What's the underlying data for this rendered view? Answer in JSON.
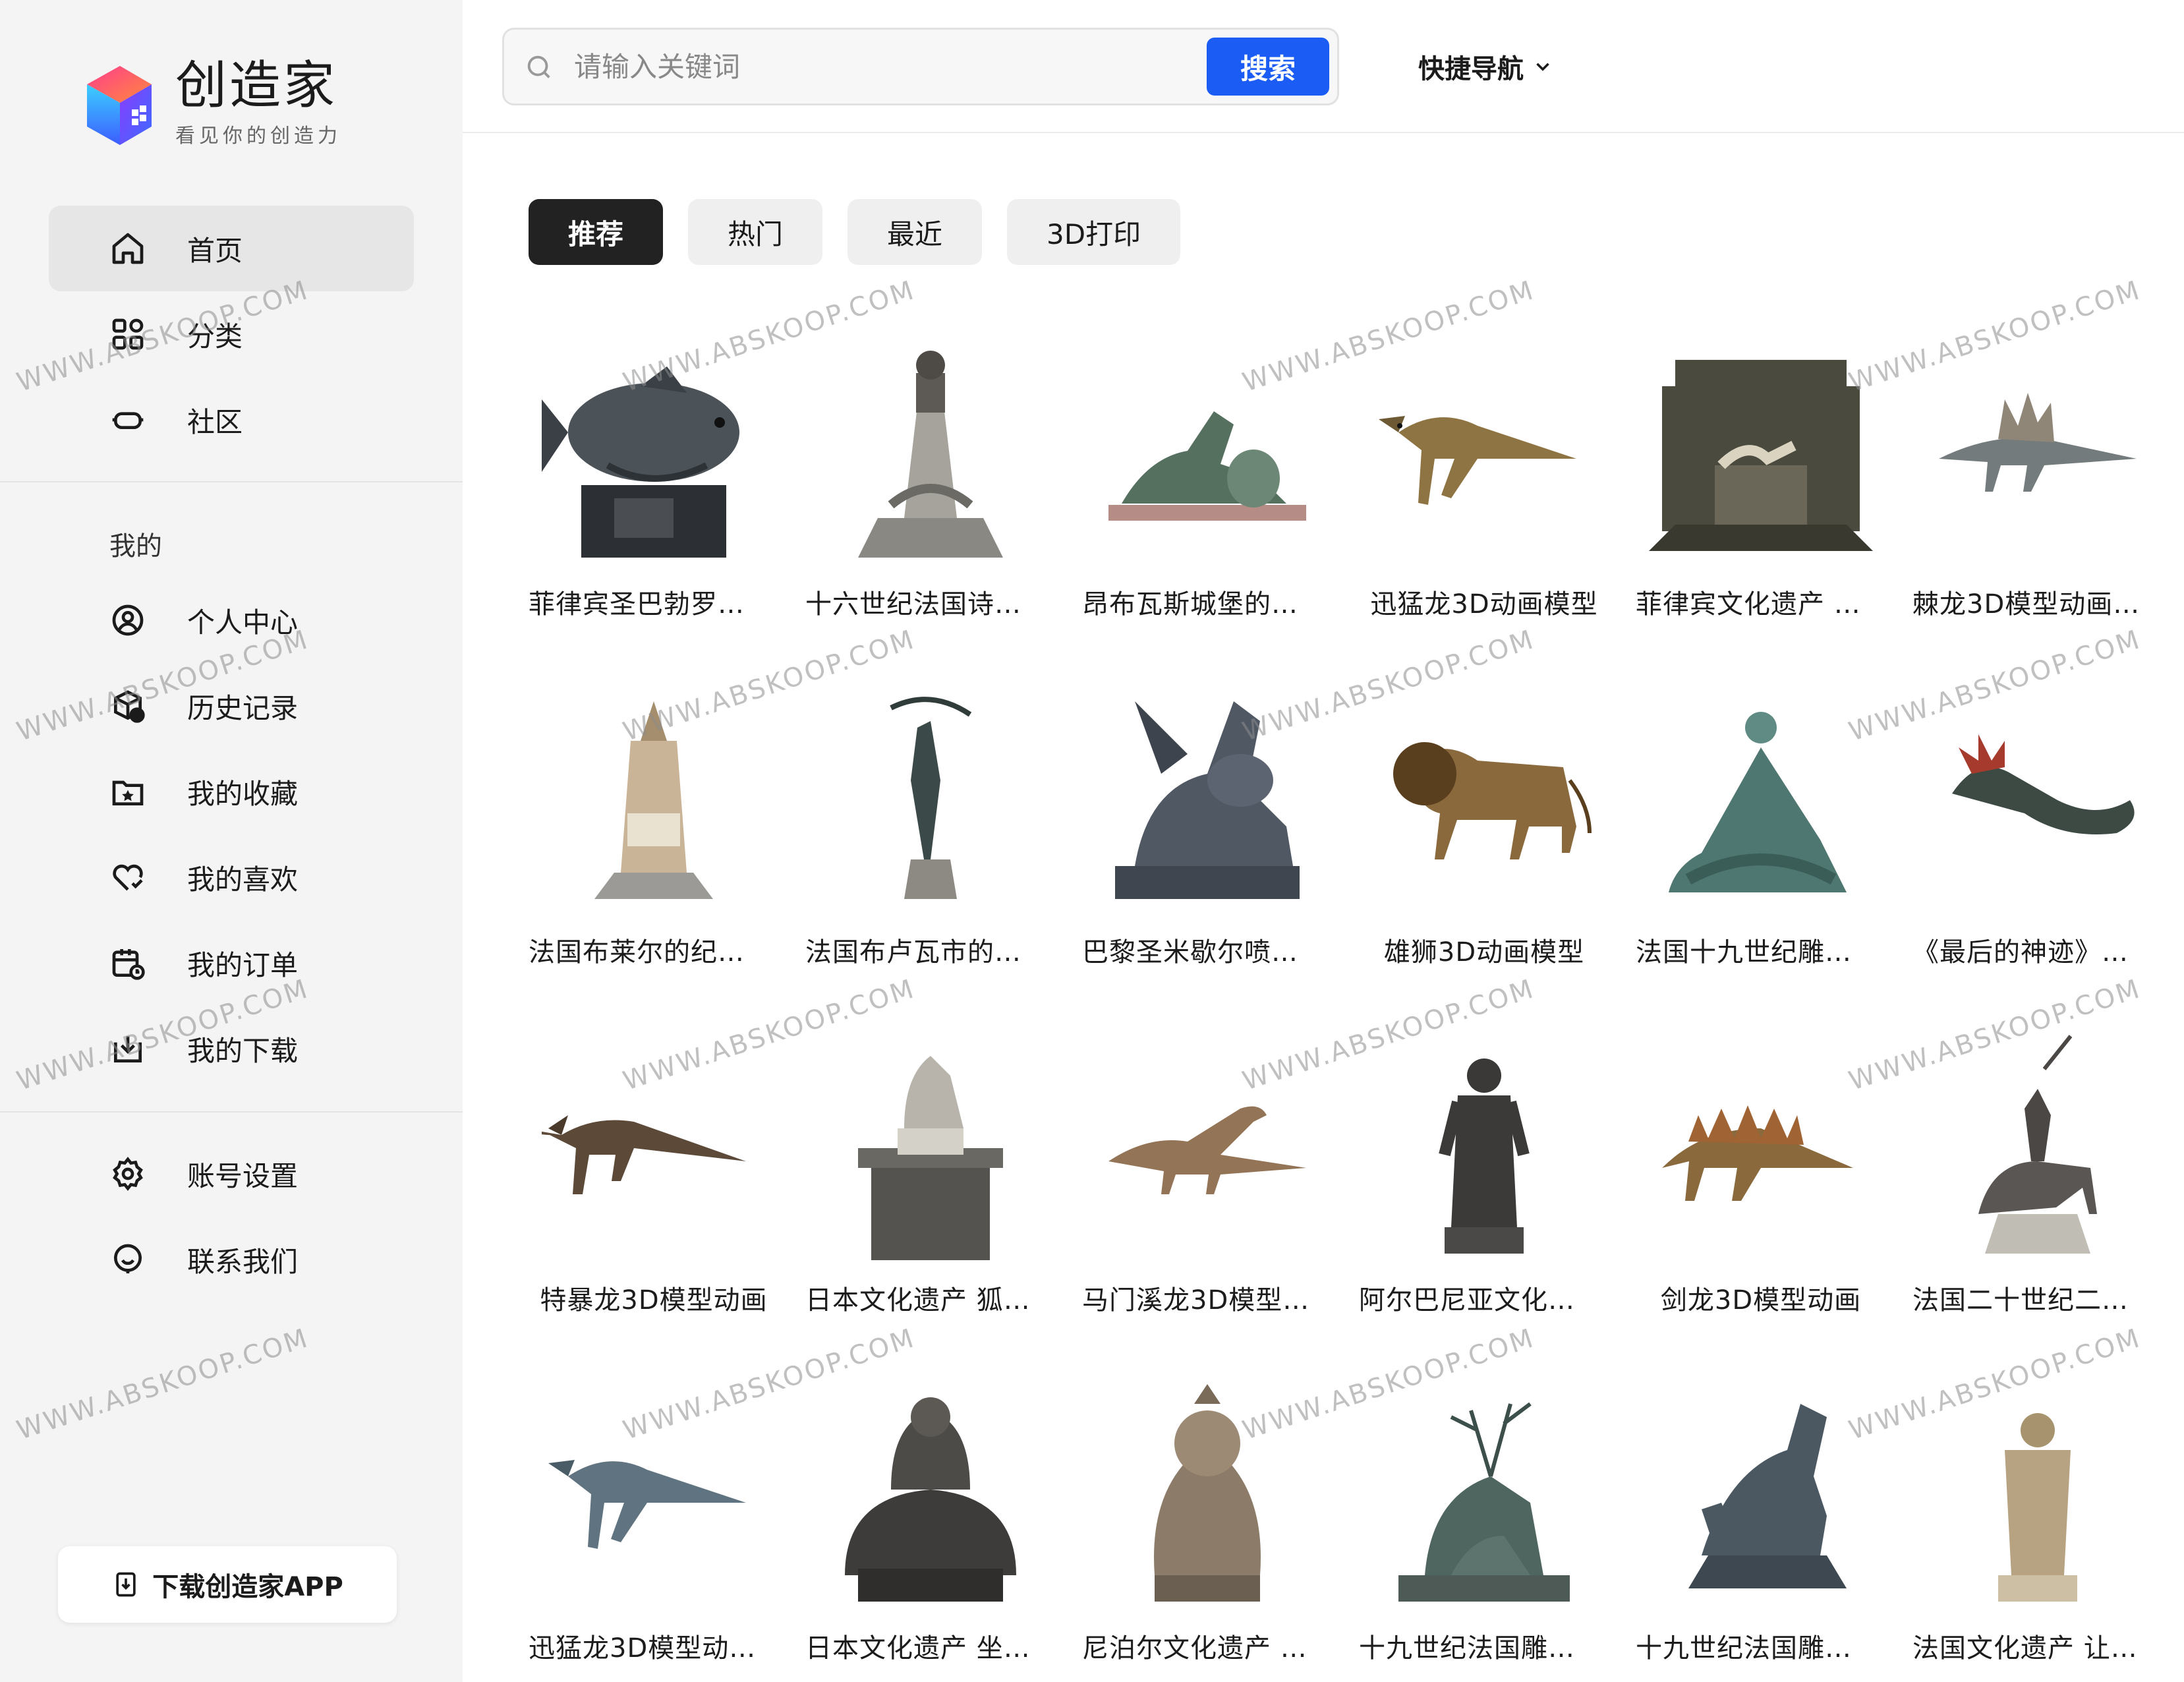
{
  "brand": {
    "title": "创造家",
    "subtitle": "看见你的创造力"
  },
  "sidebar": {
    "main_nav": [
      {
        "label": "首页",
        "icon": "home-icon",
        "active": true
      },
      {
        "label": "分类",
        "icon": "category-grid-icon"
      },
      {
        "label": "社区",
        "icon": "vr-headset-icon"
      }
    ],
    "my_section_title": "我的",
    "my_nav": [
      {
        "label": "个人中心",
        "icon": "user-circle-icon"
      },
      {
        "label": "历史记录",
        "icon": "history-box-icon"
      },
      {
        "label": "我的收藏",
        "icon": "folder-star-icon"
      },
      {
        "label": "我的喜欢",
        "icon": "heart-check-icon"
      },
      {
        "label": "我的订单",
        "icon": "calendar-clock-icon"
      },
      {
        "label": "我的下载",
        "icon": "download-box-icon"
      }
    ],
    "settings_nav": [
      {
        "label": "账号设置",
        "icon": "gear-icon"
      },
      {
        "label": "联系我们",
        "icon": "headset-smile-icon"
      }
    ],
    "download_app_label": "下载创造家APP"
  },
  "header": {
    "search_placeholder": "请输入关键词",
    "search_button": "搜索",
    "quick_nav": "快捷导航"
  },
  "tabs": [
    {
      "label": "推荐",
      "active": true
    },
    {
      "label": "热门"
    },
    {
      "label": "最近"
    },
    {
      "label": "3D打印"
    }
  ],
  "models": [
    {
      "title": "菲律宾圣巴勃罗…",
      "shape": "fish"
    },
    {
      "title": "十六世纪法国诗…",
      "shape": "monument"
    },
    {
      "title": "昂布瓦斯城堡的…",
      "shape": "reclining"
    },
    {
      "title": "迅猛龙3D动画模型",
      "shape": "raptor",
      "center": true
    },
    {
      "title": "菲律宾文化遗产 …",
      "shape": "wall"
    },
    {
      "title": "棘龙3D模型动画…",
      "shape": "spino"
    },
    {
      "title": "法国布莱尔的纪…",
      "shape": "obelisk"
    },
    {
      "title": "法国布卢瓦市的…",
      "shape": "archer"
    },
    {
      "title": "巴黎圣米歇尔喷…",
      "shape": "dragon"
    },
    {
      "title": "雄狮3D动画模型",
      "shape": "lion",
      "center": true
    },
    {
      "title": "法国十九世纪雕…",
      "shape": "group"
    },
    {
      "title": "《最后的神迹》…",
      "shape": "serpent"
    },
    {
      "title": "特暴龙3D模型动画",
      "shape": "trex",
      "center": true
    },
    {
      "title": "日本文化遗产 狐…",
      "shape": "fox"
    },
    {
      "title": "马门溪龙3D模型…",
      "shape": "sauropod"
    },
    {
      "title": "阿尔巴尼亚文化…",
      "shape": "statue"
    },
    {
      "title": "剑龙3D模型动画",
      "shape": "stego",
      "center": true
    },
    {
      "title": "法国二十世纪二…",
      "shape": "rider"
    },
    {
      "title": "迅猛龙3D模型动…",
      "shape": "raptor2"
    },
    {
      "title": "日本文化遗产 坐…",
      "shape": "buddha"
    },
    {
      "title": "尼泊尔文化遗产 …",
      "shape": "guardian"
    },
    {
      "title": "十九世纪法国雕…",
      "shape": "deer"
    },
    {
      "title": "十九世纪法国雕…",
      "shape": "horse"
    },
    {
      "title": "法国文化遗产 让…",
      "shape": "standing"
    }
  ],
  "watermark": "WWW.ABSKOOP.COM",
  "colors": {
    "accent": "#1a5cf4",
    "active_tab": "#222222",
    "sidebar_bg": "#f4f4f4"
  }
}
